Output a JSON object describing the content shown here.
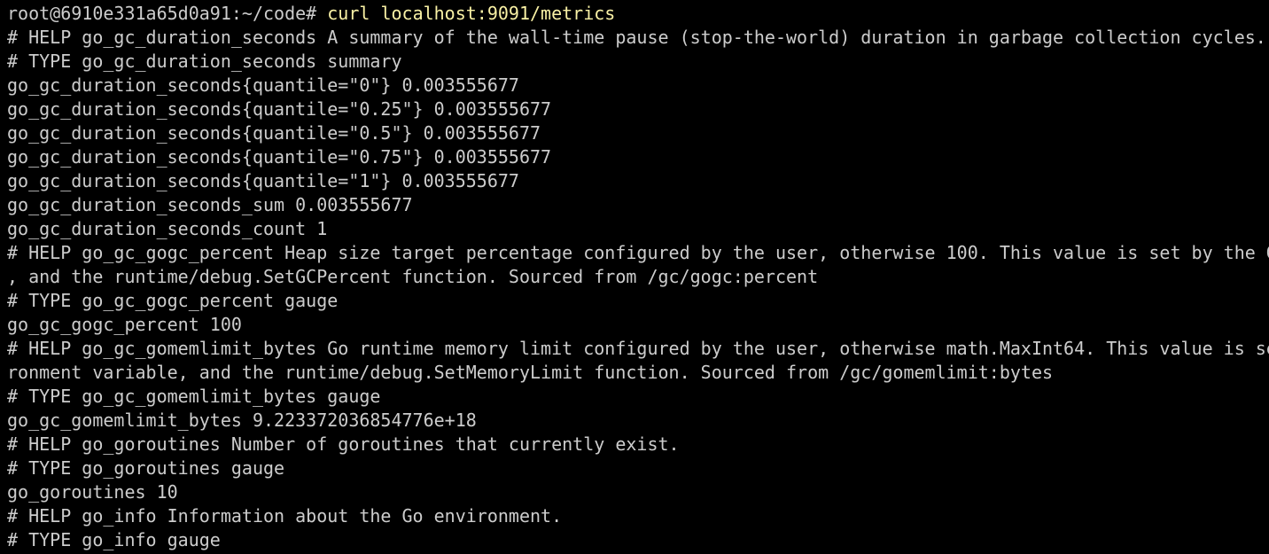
{
  "prompt": {
    "text": "root@6910e331a65d0a91:~/code# ",
    "command": "curl localhost:9091/metrics"
  },
  "output_lines": [
    "# HELP go_gc_duration_seconds A summary of the wall-time pause (stop-the-world) duration in garbage collection cycles.",
    "# TYPE go_gc_duration_seconds summary",
    "go_gc_duration_seconds{quantile=\"0\"} 0.003555677",
    "go_gc_duration_seconds{quantile=\"0.25\"} 0.003555677",
    "go_gc_duration_seconds{quantile=\"0.5\"} 0.003555677",
    "go_gc_duration_seconds{quantile=\"0.75\"} 0.003555677",
    "go_gc_duration_seconds{quantile=\"1\"} 0.003555677",
    "go_gc_duration_seconds_sum 0.003555677",
    "go_gc_duration_seconds_count 1",
    "# HELP go_gc_gogc_percent Heap size target percentage configured by the user, otherwise 100. This value is set by the G",
    ", and the runtime/debug.SetGCPercent function. Sourced from /gc/gogc:percent",
    "# TYPE go_gc_gogc_percent gauge",
    "go_gc_gogc_percent 100",
    "# HELP go_gc_gomemlimit_bytes Go runtime memory limit configured by the user, otherwise math.MaxInt64. This value is se",
    "ronment variable, and the runtime/debug.SetMemoryLimit function. Sourced from /gc/gomemlimit:bytes",
    "# TYPE go_gc_gomemlimit_bytes gauge",
    "go_gc_gomemlimit_bytes 9.223372036854776e+18",
    "# HELP go_goroutines Number of goroutines that currently exist.",
    "# TYPE go_goroutines gauge",
    "go_goroutines 10",
    "# HELP go_info Information about the Go environment.",
    "# TYPE go_info gauge"
  ],
  "colors": {
    "background": "#000000",
    "text": "#cccccc",
    "command": "#f9f1a5"
  }
}
